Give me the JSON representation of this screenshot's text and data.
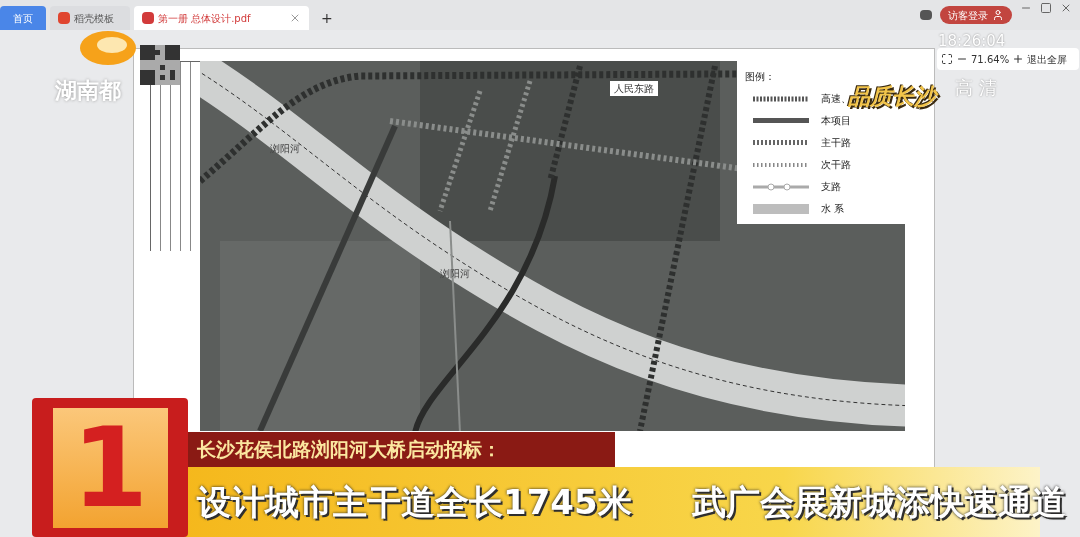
{
  "browser": {
    "tabs": [
      {
        "label": "首页",
        "selected": false,
        "kind": "home"
      },
      {
        "label": "稻壳模板",
        "selected": false,
        "kind": "app"
      },
      {
        "label": "第一册 总体设计.pdf",
        "selected": true,
        "kind": "pdf"
      }
    ],
    "new_tab": "+",
    "login": "访客登录"
  },
  "viewer": {
    "zoom": "71.64%",
    "exit_fullscreen": "退出全屏"
  },
  "map": {
    "labels": [
      {
        "text": "人民东路",
        "kind": "road"
      },
      {
        "text": "浏阳河",
        "kind": "river"
      },
      {
        "text": "浏阳河",
        "kind": "river"
      }
    ],
    "legend": {
      "title": "图例：",
      "items": [
        {
          "label": "高速、",
          "kind": "highway"
        },
        {
          "label": "本项目",
          "kind": "project"
        },
        {
          "label": "主干路",
          "kind": "main"
        },
        {
          "label": "次干路",
          "kind": "secondary"
        },
        {
          "label": "支路",
          "kind": "branch"
        },
        {
          "label": "水 系",
          "kind": "water"
        }
      ]
    }
  },
  "overlay": {
    "channel_logo": "湖南都",
    "clock": "18:26:04",
    "quality": "高 清",
    "program_logo": "品质长沙",
    "rank_badge": "1",
    "headline": "长沙花侯北路浏阳河大桥启动招标：",
    "subtitles": [
      "设计城市主干道全长1745米",
      "武广会展新城添快速通道"
    ]
  }
}
